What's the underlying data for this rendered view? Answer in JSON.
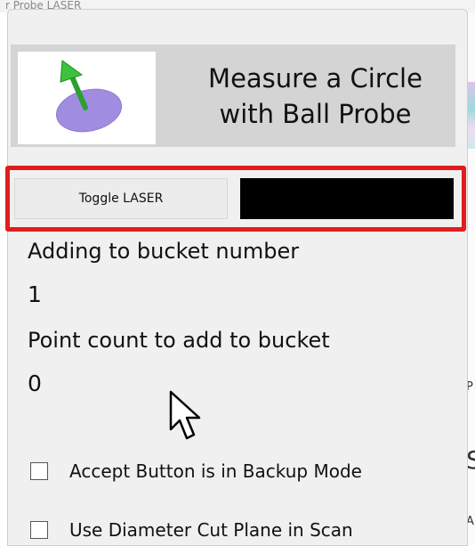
{
  "background_window": {
    "title_fragment": "r Probe LASER"
  },
  "panel": {
    "title": "Measure a Circle\nwith Ball Probe",
    "icon": "circle-probe-icon",
    "toggle_laser_label": "Toggle LASER",
    "laser_indicator_color": "#000000",
    "highlight_color": "#e11d1d",
    "bucket_label": "Adding to bucket number",
    "bucket_value": "1",
    "point_count_label": "Point count to add to bucket",
    "point_count_value": "0",
    "options": [
      {
        "label": "Accept Button is in Backup Mode",
        "checked": false
      },
      {
        "label": "Use Diameter Cut Plane in Scan",
        "checked": false
      }
    ]
  },
  "edge_fragments": [
    "P",
    "S",
    "A"
  ]
}
